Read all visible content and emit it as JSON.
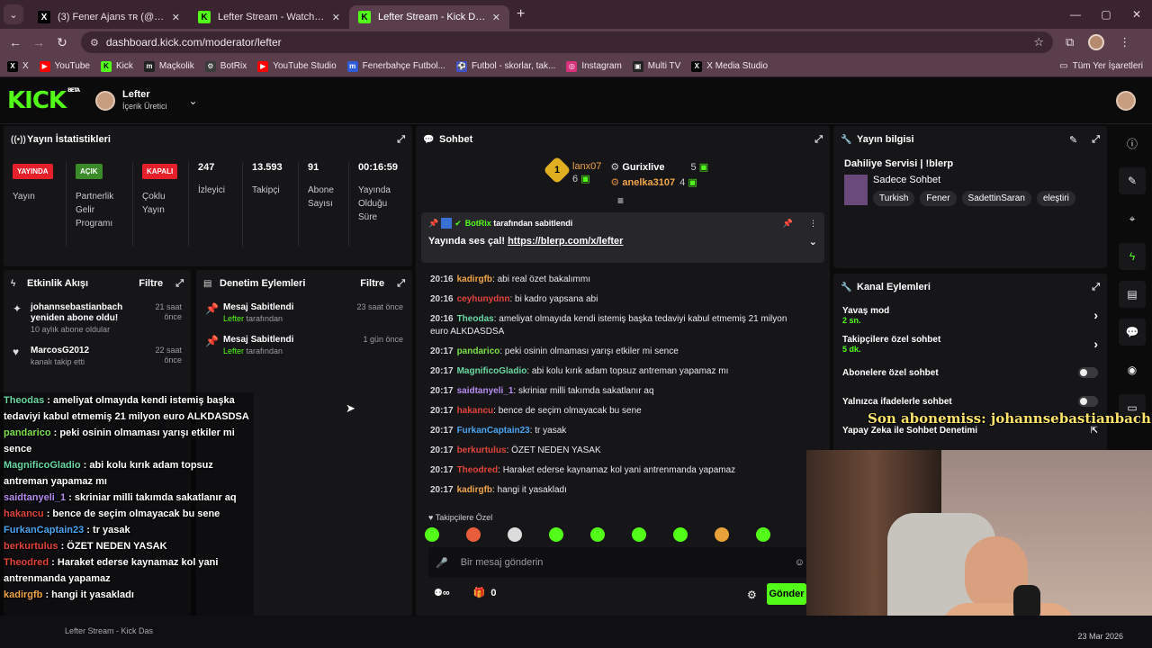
{
  "browser": {
    "tabs": [
      {
        "icon": "x-icon",
        "title": "(3) Fener Ajans ᴛʀ (@ajansfener...",
        "active": false
      },
      {
        "icon": "kick-icon",
        "title": "Lefter Stream - Watch Live on K...",
        "active": false
      },
      {
        "icon": "kick-icon",
        "title": "Lefter Stream - Kick Dashboard",
        "active": true
      }
    ],
    "url": "dashboard.kick.com/moderator/lefter",
    "bookmarks": [
      {
        "label": "X",
        "icon": "x-icon",
        "color": "#000000"
      },
      {
        "label": "YouTube",
        "icon": "youtube-icon",
        "color": "#ff0000"
      },
      {
        "label": "Kick",
        "icon": "kick-icon",
        "color": "#53fc18"
      },
      {
        "label": "Maçkolik",
        "icon": "mackolik-icon",
        "color": "#222222"
      },
      {
        "label": "BotRix",
        "icon": "botrix-icon",
        "color": "#3a3a3a"
      },
      {
        "label": "YouTube Studio",
        "icon": "youtube-icon",
        "color": "#ff0000"
      },
      {
        "label": "Fenerbahçe Futbol...",
        "icon": "m-icon",
        "color": "#2d5bd7"
      },
      {
        "label": "Futbol - skorlar, tak...",
        "icon": "futbol-icon",
        "color": "#4050c8"
      },
      {
        "label": "Instagram",
        "icon": "instagram-icon",
        "color": "#d9307a"
      },
      {
        "label": "Multi TV",
        "icon": "tv-icon",
        "color": "#222222"
      },
      {
        "label": "X Media Studio",
        "icon": "x-icon",
        "color": "#000000"
      }
    ],
    "all_bookmarks": "Tüm Yer İşaretleri"
  },
  "header": {
    "logo": "KICK",
    "beta": "BETA",
    "channel": "Lefter",
    "role": "İçerik Üretici"
  },
  "stats": {
    "title": "Yayın İstatistikleri",
    "items": [
      {
        "badge": "YAYINDA",
        "badge_color": "#e5202b",
        "label": "Yayın"
      },
      {
        "badge": "AÇIK",
        "badge_color": "#3b8b2a",
        "label": "Partnerlik Gelir Programı"
      },
      {
        "badge": "KAPALI",
        "badge_color": "#e5202b",
        "label": "Çoklu Yayın"
      },
      {
        "value": "247",
        "label": "İzleyici"
      },
      {
        "value": "13.593",
        "label": "Takipçi"
      },
      {
        "value": "91",
        "label": "Abone Sayısı"
      },
      {
        "value": "00:16:59",
        "label": "Yayında Olduğu Süre"
      }
    ]
  },
  "activity": {
    "title": "Etkinlik Akışı",
    "filter": "Filtre",
    "items": [
      {
        "icon": "sparkle-icon",
        "name": "johannsebastianbach yeniden abone oldu!",
        "sub": "10 aylık abone oldular",
        "time": "21 saat önce"
      },
      {
        "icon": "heart-icon",
        "name": "MarcosG2012",
        "sub": "kanalı takip etti",
        "time": "22 saat önce"
      }
    ]
  },
  "moderation": {
    "title": "Denetim Eylemleri",
    "filter": "Filtre",
    "items": [
      {
        "title": "Mesaj Sabitlendi",
        "by": "Lefter",
        "suffix": "tarafından",
        "time": "23 saat önce"
      },
      {
        "title": "Mesaj Sabitlendi",
        "by": "Lefter",
        "suffix": "tarafından",
        "time": "1 gün önce"
      }
    ]
  },
  "chat": {
    "title": "Sohbet",
    "leaders": [
      {
        "rank": "1",
        "name": "lanx07",
        "count": "6"
      },
      {
        "name": "Gurixlive",
        "count": "5"
      },
      {
        "name": "anelka3107",
        "count": "4"
      }
    ],
    "pinned": {
      "by": "BotRix",
      "suffix": "tarafından sabitlendi",
      "text": "Yayında ses çal!",
      "link": "https://blerp.com/x/lefter"
    },
    "messages": [
      {
        "time": "20:16",
        "user": "kadirgfb",
        "color": "#f0a44a",
        "text": ": abi real özet bakalımmı"
      },
      {
        "time": "20:16",
        "user": "ceyhunydnn",
        "color": "#e0443a",
        "text": ": bi kadro yapsana abi"
      },
      {
        "time": "20:16",
        "user": "Theodas",
        "color": "#6ad7a2",
        "text": ": ameliyat olmayıda kendi istemiş başka tedaviyi kabul etmemiş 21 milyon euro ALKDASDSA"
      },
      {
        "time": "20:17",
        "user": "pandarico",
        "color": "#7be04a",
        "text": ": peki osinin olmaması yarışı etkiler mi sence"
      },
      {
        "time": "20:17",
        "user": "MagnificoGladio",
        "color": "#6ad7a2",
        "text": ": abi kolu kırık adam topsuz antreman yapamaz mı"
      },
      {
        "time": "20:17",
        "user": "saidtanyeli_1",
        "color": "#b58cf0",
        "text": ": skriniar milli takımda sakatlanır aq"
      },
      {
        "time": "20:17",
        "user": "hakancu",
        "color": "#e0443a",
        "text": ": bence de seçim olmayacak bu sene"
      },
      {
        "time": "20:17",
        "user": "FurkanCaptain23",
        "color": "#4aa3f0",
        "text": ": tr yasak"
      },
      {
        "time": "20:17",
        "user": "berkurtulus",
        "color": "#e0443a",
        "text": ": ÖZET NEDEN YASAK"
      },
      {
        "time": "20:17",
        "user": "Theodred",
        "color": "#e0443a",
        "text": ": Haraket ederse kaynamaz kol yani antrenmanda yapamaz"
      },
      {
        "time": "20:17",
        "user": "kadirgfb",
        "color": "#f0a44a",
        "text": ": hangi it yasakladı"
      }
    ],
    "followers_only": "Takipçilere Özel",
    "placeholder": "Bir mesaj gönderin",
    "send": "Gönder",
    "viewer_count": "0"
  },
  "stream_info": {
    "title": "Yayın bilgisi",
    "stream_title": "Dahiliye Servisi | !blerp",
    "category": "Sadece Sohbet",
    "tags": [
      "Turkish",
      "Fener",
      "SadettinSaran",
      "eleştiri"
    ]
  },
  "channel_actions": {
    "title": "Kanal Eylemleri",
    "rows": [
      {
        "label": "Yavaş mod",
        "sub": "2 sn."
      },
      {
        "label": "Takipçilere özel sohbet",
        "sub": "5 dk."
      },
      {
        "label": "Abonelere özel sohbet"
      },
      {
        "label": "Yalnızca ifadelerle sohbet"
      },
      {
        "label": "Yapay Zeka ile Sohbet Denetimi"
      }
    ]
  },
  "overlay": {
    "banner": "Son abonemiss: johannsebastianbach",
    "lines": [
      {
        "user": "Theodas",
        "color": "#6ad7a2",
        "text": " : ameliyat olmayıda kendi istemiş başka tedaviyi kabul etmemiş 21 milyon euro ALKDASDSA"
      },
      {
        "user": "pandarico",
        "color": "#7be04a",
        "text": " : peki osinin olmaması yarışı etkiler mi sence"
      },
      {
        "user": "MagnificoGladio",
        "color": "#6ad7a2",
        "text": " : abi kolu kırık adam topsuz antreman yapamaz mı"
      },
      {
        "user": "saidtanyeli_1",
        "color": "#b58cf0",
        "text": " : skriniar milli takımda sakatlanır aq"
      },
      {
        "user": "hakancu",
        "color": "#e0443a",
        "text": " : bence de seçim olmayacak bu sene"
      },
      {
        "user": "FurkanCaptain23",
        "color": "#4aa3f0",
        "text": " : tr yasak"
      },
      {
        "user": "berkurtulus",
        "color": "#e0443a",
        "text": " : ÖZET NEDEN YASAK"
      },
      {
        "user": "Theodred",
        "color": "#e0443a",
        "text": " : Haraket ederse kaynamaz kol yani antrenmanda yapamaz"
      },
      {
        "user": "kadirgfb",
        "color": "#f0a44a",
        "text": " : hangi it yasakladı"
      }
    ]
  },
  "taskbar": {
    "date": "23 Mar 2026",
    "window": "Lefter Stream - Kick Das"
  }
}
